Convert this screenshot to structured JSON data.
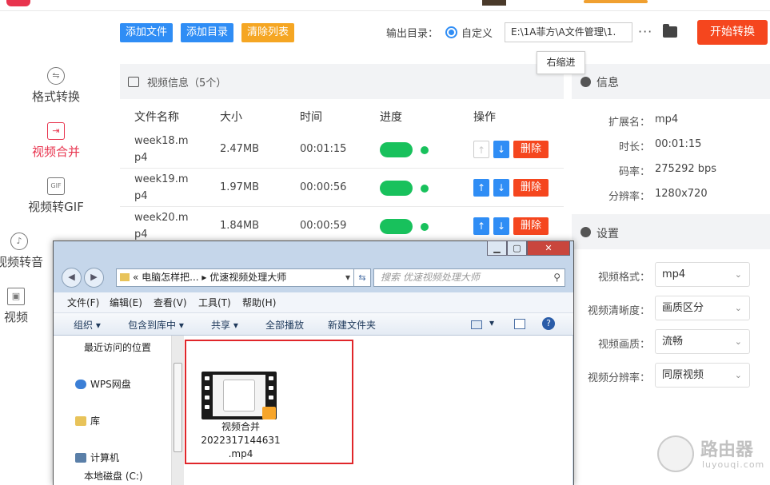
{
  "toolbar": {
    "add_file": "添加文件",
    "add_dir": "添加目录",
    "clear_list": "清除列表",
    "output_label": "输出目录：",
    "custom_label": "自定义",
    "output_path": "E:\\1A菲方\\A文件管理\\1.",
    "more": "···",
    "start": "开始转换",
    "tooltip": "右缩进"
  },
  "sidebar": {
    "items": [
      {
        "label": "格式转换",
        "icon": "format-convert-icon"
      },
      {
        "label": "视频合并",
        "icon": "video-merge-icon"
      },
      {
        "label": "视频转GIF",
        "icon": "gif-icon"
      },
      {
        "label": "视频转音",
        "icon": "audio-icon"
      },
      {
        "label": "视频",
        "icon": "video-icon"
      }
    ]
  },
  "list": {
    "title": "视频信息（5个）",
    "columns": [
      "文件名称",
      "大小",
      "时间",
      "进度",
      "操作"
    ],
    "rows": [
      {
        "name": "week18.mp4",
        "size": "2.47MB",
        "time": "00:01:15",
        "delete": "删除"
      },
      {
        "name": "week19.mp4",
        "size": "1.97MB",
        "time": "00:00:56",
        "delete": "删除"
      },
      {
        "name": "week20.mp4",
        "size": "1.84MB",
        "time": "00:00:59",
        "delete": "删除"
      }
    ]
  },
  "info": {
    "title": "信息",
    "fields": [
      {
        "key": "扩展名：",
        "value": "mp4"
      },
      {
        "key": "时长：",
        "value": "00:01:15"
      },
      {
        "key": "码率：",
        "value": "275292 bps"
      },
      {
        "key": "分辨率：",
        "value": "1280x720"
      }
    ]
  },
  "settings": {
    "title": "设置",
    "fields": [
      {
        "key": "视频格式：",
        "value": "mp4"
      },
      {
        "key": "视频清晰度：",
        "value": "画质区分"
      },
      {
        "key": "视频画质：",
        "value": "流畅"
      },
      {
        "key": "视频分辨率：",
        "value": "同原视频"
      }
    ]
  },
  "explorer": {
    "address": "«  电脑怎样把...  ▸  优速视频处理大师",
    "search_placeholder": "搜索 优速视频处理大师",
    "menu": [
      "文件(F)",
      "编辑(E)",
      "查看(V)",
      "工具(T)",
      "帮助(H)"
    ],
    "commands": [
      "组织 ▾",
      "包含到库中 ▾",
      "共享 ▾",
      "全部播放",
      "新建文件夹"
    ],
    "nav": [
      "最近访问的位置",
      "WPS网盘",
      "库",
      "计算机",
      "本地磁盘 (C:)"
    ],
    "file_name_lines": [
      "视频合并",
      "2022317144631",
      ".mp4"
    ]
  },
  "watermark": {
    "main": "路由器",
    "sub": "luyouqi.com"
  }
}
